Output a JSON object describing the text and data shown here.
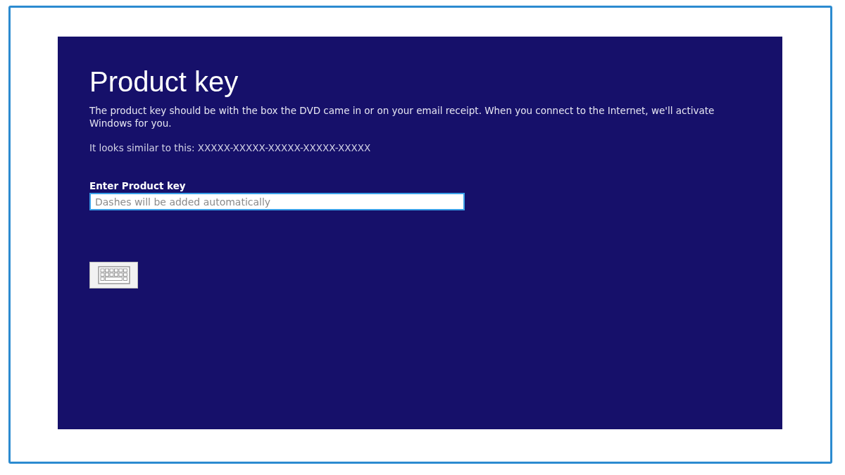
{
  "title": "Product key",
  "description": "The product key should be with the box the DVD came in or on your email receipt. When you connect to the Internet, we'll activate Windows for you.",
  "example": "It looks similar to this: XXXXX-XXXXX-XXXXX-XXXXX-XXXXX",
  "key_field": {
    "label": "Enter Product key",
    "placeholder": "Dashes will be added automatically"
  },
  "keyboard_button": {
    "kind": "keyboard"
  }
}
